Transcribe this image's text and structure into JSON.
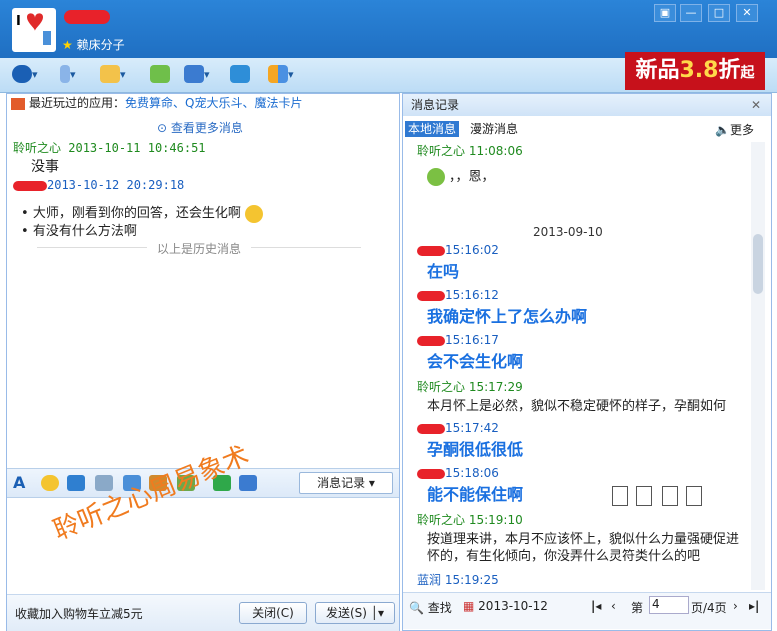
{
  "window": {
    "status_line": "赖床分子",
    "buttons": [
      "▣",
      "—",
      "□",
      "✕"
    ]
  },
  "ad": {
    "prefix": "新品",
    "num": "3.8",
    "suffix": "折",
    "tail": "起"
  },
  "left": {
    "recent_label": "最近玩过的应用：",
    "recent_apps": "免费算命、Q宠大乐斗、魔法卡片",
    "more_messages": "查看更多消息",
    "msg1": {
      "sender": "聆听之心",
      "time": "2013-10-11 10:46:51",
      "text": "没事"
    },
    "msg2": {
      "time": "2013-10-12 20:29:18",
      "line1": "大师，刚看到你的回答，还会生化啊",
      "line2": "有没有什么方法啊"
    },
    "history_sep": "以上是历史消息",
    "msg_record_btn": "消息记录",
    "watermark": "聆听之心周易象术",
    "promo": "收藏加入购物车立减5元",
    "close_btn": "关闭(C)",
    "send_btn": "发送(S)"
  },
  "right": {
    "title": "消息记录",
    "tab_local": "本地消息",
    "tab_roam": "漫游消息",
    "more": "更多",
    "entries": [
      {
        "who": "聆听之心",
        "time": "11:08:06",
        "text": "，，恩，",
        "style": "normal",
        "nameColor": "green"
      },
      {
        "date": "2013-09-10"
      },
      {
        "who": "",
        "time": "15:16:02",
        "text": "在吗",
        "style": "big",
        "nameColor": "blue"
      },
      {
        "who": "",
        "time": "15:16:12",
        "text": "我确定怀上了怎么办啊",
        "style": "big",
        "nameColor": "blue"
      },
      {
        "who": "",
        "time": "15:16:17",
        "text": "会不会生化啊",
        "style": "big",
        "nameColor": "blue"
      },
      {
        "who": "聆听之心",
        "time": "15:17:29",
        "text": "本月怀上是必然，貌似不稳定硬怀的样子，孕酮如何",
        "style": "normal",
        "nameColor": "green"
      },
      {
        "who": "",
        "time": "15:17:42",
        "text": "孕酮很低很低",
        "style": "big",
        "nameColor": "blue"
      },
      {
        "who": "",
        "time": "15:18:06",
        "text": "能不能保住啊",
        "style": "big",
        "nameColor": "blue"
      },
      {
        "who": "聆听之心",
        "time": "15:19:10",
        "text": "按道理来讲，本月不应该怀上，貌似什么力量强硬促进怀的，有生化倾向，你没弄什么灵符类什么的吧",
        "style": "normal",
        "nameColor": "green"
      },
      {
        "who": "蓝润",
        "time": "15:19:25",
        "text": "",
        "style": "normal",
        "nameColor": "blue"
      }
    ],
    "search": "查找",
    "date": "2013-10-12",
    "page_prefix": "第",
    "page_value": "4",
    "page_suffix": "页/4页"
  }
}
